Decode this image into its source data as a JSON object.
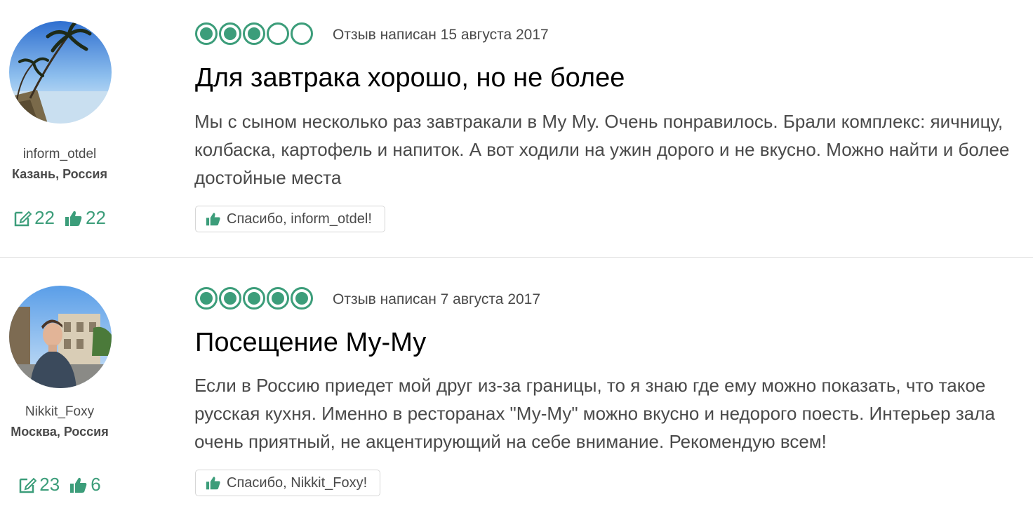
{
  "accent_color": "#3c9d7a",
  "reviews": [
    {
      "avatar": "tropical-beach-palm-photo",
      "username": "inform_otdel",
      "location": "Казань, Россия",
      "reviews_count": "22",
      "helpful_count": "22",
      "rating_bubbles": 3,
      "rating_max": 5,
      "date": "Отзыв написан 15 августа 2017",
      "title": "Для завтрака хорошо, но не более",
      "text": "Мы с сыном несколько раз завтракали в Му Му. Очень понравилось. Брали комплекс: яичницу, колбаска, картофель и напиток. А вот ходили на ужин дорого и не вкусно. Можно найти и более достойные места",
      "thanks_label": "Спасибо, inform_otdel!"
    },
    {
      "avatar": "man-selfie-street-photo",
      "username": "Nikkit_Foxy",
      "location": "Москва, Россия",
      "reviews_count": "23",
      "helpful_count": "6",
      "rating_bubbles": 5,
      "rating_max": 5,
      "date": "Отзыв написан 7 августа 2017",
      "title": "Посещение Му-Му",
      "text": "Если в Россию приедет мой друг из-за границы, то я знаю где ему можно показать, что такое русская кухня. Именно в ресторанах \"Му-Му\" можно вкусно и недорого поесть. Интерьер зала очень приятный, не акцентирующий на себе внимание. Рекомендую всем!",
      "thanks_label": "Спасибо, Nikkit_Foxy!"
    }
  ]
}
